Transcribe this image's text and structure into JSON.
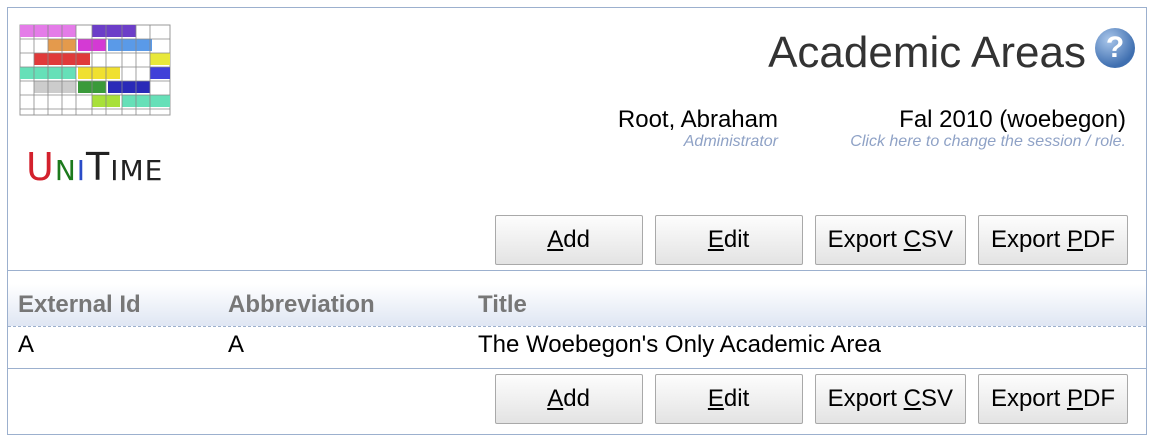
{
  "logo": {
    "name": "UniTime"
  },
  "header": {
    "title": "Academic Areas",
    "help_icon": "question-mark-icon"
  },
  "user": {
    "name": "Root, Abraham",
    "role": "Administrator"
  },
  "session": {
    "name": "Fal 2010 (woebegon)",
    "hint": "Click here to change the session / role."
  },
  "buttons": {
    "add": {
      "accel": "A",
      "rest": "dd"
    },
    "edit": {
      "accel": "E",
      "rest": "dit"
    },
    "export_csv": {
      "pre": "Export ",
      "accel": "C",
      "rest": "SV"
    },
    "export_pdf": {
      "pre": "Export ",
      "accel": "P",
      "rest": "DF"
    }
  },
  "table": {
    "columns": [
      "External Id",
      "Abbreviation",
      "Title"
    ],
    "rows": [
      [
        "A",
        "A",
        "The Woebegon's Only Academic Area"
      ]
    ]
  },
  "colors": {
    "border": "#9cb0ce",
    "hint": "#8fa2c6",
    "header_bg": "#dfe6f3"
  }
}
